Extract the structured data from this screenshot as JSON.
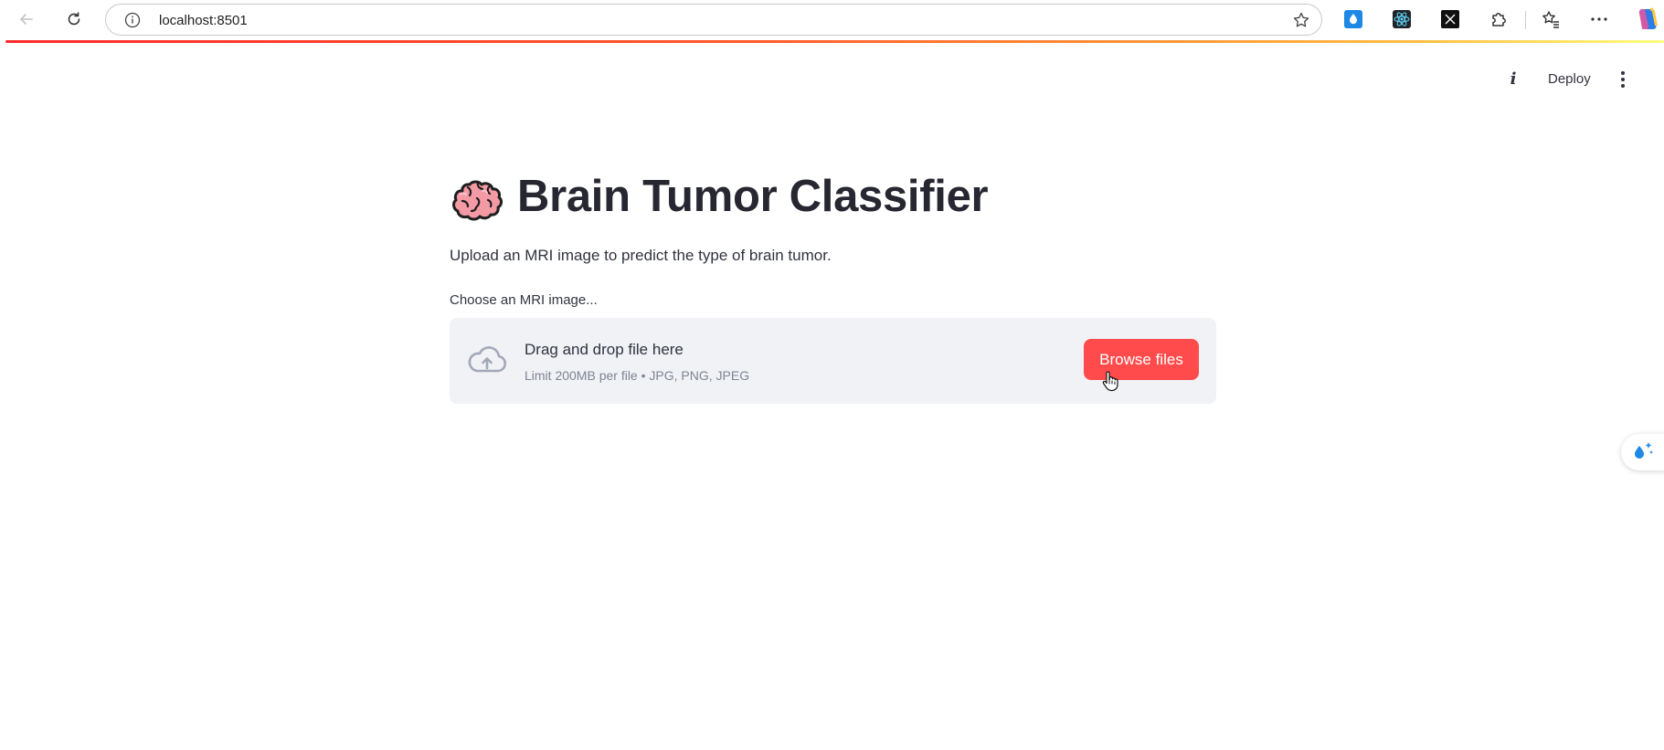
{
  "browser": {
    "url": "localhost:8501"
  },
  "header": {
    "deploy_label": "Deploy"
  },
  "app": {
    "title_emoji": "🧠",
    "title": "Brain Tumor Classifier",
    "subtitle": "Upload an MRI image to predict the type of brain tumor.",
    "uploader": {
      "label": "Choose an MRI image...",
      "drop_text": "Drag and drop file here",
      "limit_text": "Limit 200MB per file • JPG, PNG, JPEG",
      "button_label": "Browse files"
    }
  },
  "colors": {
    "primary": "#ff4b4b",
    "dropzone_bg": "#f0f2f6",
    "text": "#31333f",
    "muted_text": "#808495"
  },
  "icons": [
    "back-icon",
    "refresh-icon",
    "info-icon",
    "star-icon",
    "extension-icons",
    "favorites-icon",
    "more-icon",
    "copilot-icon",
    "kebab-icon",
    "upload-cloud-icon",
    "brain-icon",
    "hand-cursor-icon"
  ]
}
